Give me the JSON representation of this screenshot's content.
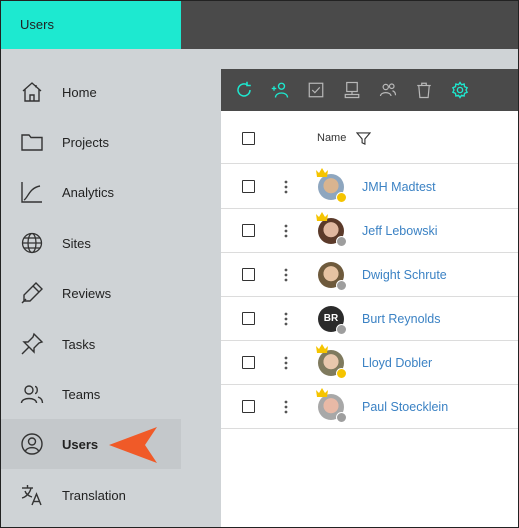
{
  "top_tab": {
    "label": "Users"
  },
  "sidebar": {
    "items": [
      {
        "label": "Home",
        "icon": "home-icon"
      },
      {
        "label": "Projects",
        "icon": "folder-icon"
      },
      {
        "label": "Analytics",
        "icon": "analytics-icon"
      },
      {
        "label": "Sites",
        "icon": "globe-icon"
      },
      {
        "label": "Reviews",
        "icon": "pen-icon"
      },
      {
        "label": "Tasks",
        "icon": "pin-icon"
      },
      {
        "label": "Teams",
        "icon": "teams-icon"
      },
      {
        "label": "Users",
        "icon": "user-icon",
        "active": true
      },
      {
        "label": "Translation",
        "icon": "translate-icon"
      }
    ]
  },
  "toolbar": {
    "icons": [
      "refresh-icon",
      "add-user-icon",
      "checklist-icon",
      "computer-icon",
      "users-icon",
      "trash-icon",
      "settings-icon"
    ],
    "accent": "#1de9d0",
    "muted": "#b8b8b8"
  },
  "table": {
    "column_name": "Name",
    "rows": [
      {
        "name": "JMH Madtest",
        "crown": true,
        "status": "#f5c400",
        "avatar": "photo"
      },
      {
        "name": "Jeff Lebowski",
        "crown": true,
        "status": "#9e9e9e",
        "avatar": "photo"
      },
      {
        "name": "Dwight Schrute",
        "crown": false,
        "status": "#9e9e9e",
        "avatar": "photo"
      },
      {
        "name": "Burt Reynolds",
        "crown": false,
        "status": "#9e9e9e",
        "avatar": "initials",
        "initials": "BR"
      },
      {
        "name": "Lloyd Dobler",
        "crown": true,
        "status": "#f5c400",
        "avatar": "photo"
      },
      {
        "name": "Paul Stoecklein",
        "crown": true,
        "status": "#9e9e9e",
        "avatar": "photo"
      }
    ]
  },
  "colors": {
    "accent": "#1de9d0",
    "link": "#3b82c4",
    "pointer": "#f05a28",
    "crown": "#f5c400"
  }
}
